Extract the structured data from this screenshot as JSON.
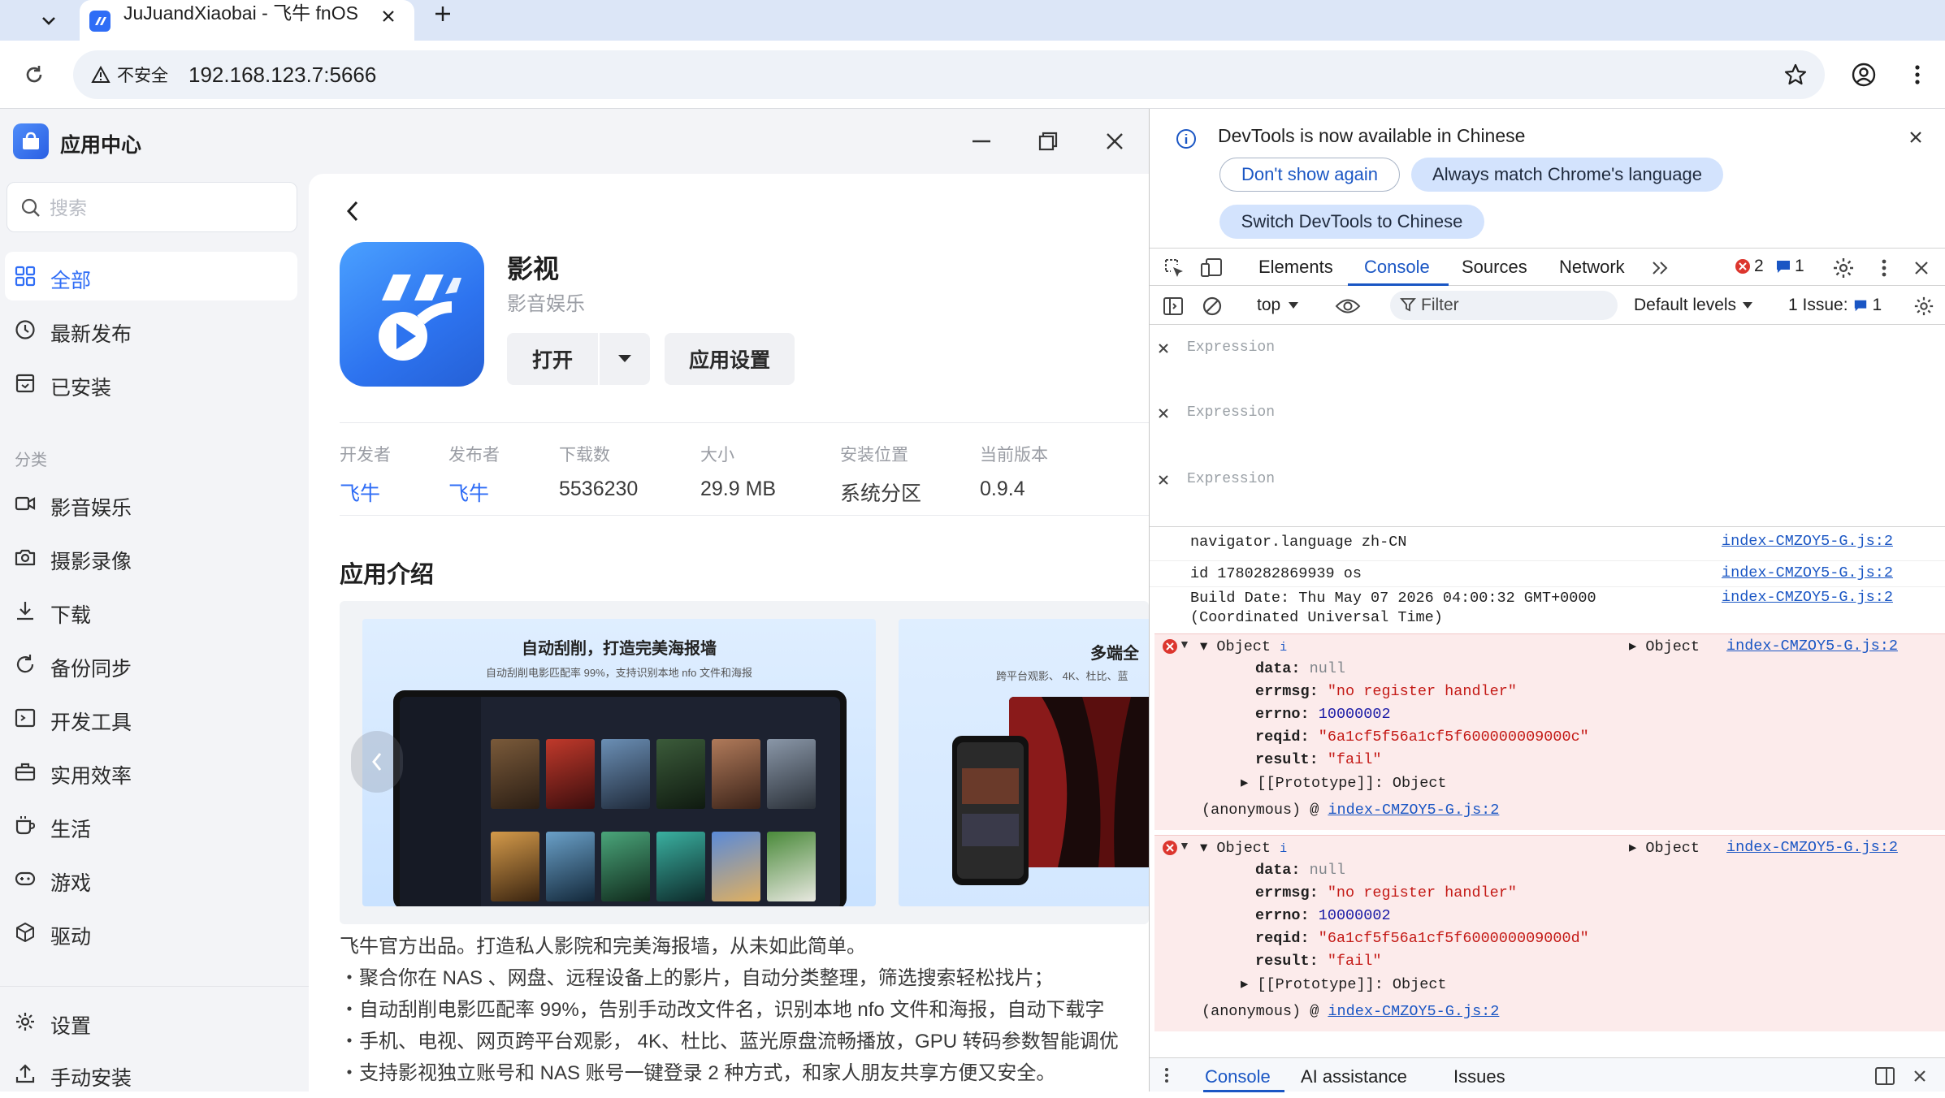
{
  "browser": {
    "tab_title": "JuJuandXiaobai - 飞牛 fnOS",
    "security_label": "不安全",
    "url": "192.168.123.7:5666",
    "favicon_color": "#2f6df6"
  },
  "app": {
    "window_title": "应用中心",
    "search_placeholder": "搜索",
    "nav": [
      {
        "label": "全部",
        "icon": "grid-icon",
        "active": true
      },
      {
        "label": "最新发布",
        "icon": "clock-icon"
      },
      {
        "label": "已安装",
        "icon": "installed-icon"
      }
    ],
    "category_heading": "分类",
    "categories": [
      {
        "label": "影音娱乐",
        "icon": "video-camera-icon"
      },
      {
        "label": "摄影录像",
        "icon": "camera-icon"
      },
      {
        "label": "下载",
        "icon": "download-icon"
      },
      {
        "label": "备份同步",
        "icon": "sync-icon"
      },
      {
        "label": "开发工具",
        "icon": "terminal-icon"
      },
      {
        "label": "实用效率",
        "icon": "toolbox-icon"
      },
      {
        "label": "生活",
        "icon": "cup-icon"
      },
      {
        "label": "游戏",
        "icon": "gamepad-icon"
      },
      {
        "label": "驱动",
        "icon": "cube-icon"
      }
    ],
    "bottom_nav": [
      {
        "label": "设置",
        "icon": "gear-icon"
      },
      {
        "label": "手动安装",
        "icon": "upload-icon"
      }
    ],
    "accent_color": "#2f6df6"
  },
  "detail": {
    "name": "影视",
    "category": "影音娱乐",
    "open_label": "打开",
    "settings_label": "应用设置",
    "meta": [
      {
        "key": "开发者",
        "value": "飞牛",
        "link": true
      },
      {
        "key": "发布者",
        "value": "飞牛",
        "link": true
      },
      {
        "key": "下载数",
        "value": "5536230"
      },
      {
        "key": "大小",
        "value": "29.9 MB"
      },
      {
        "key": "安装位置",
        "value": "系统分区"
      },
      {
        "key": "当前版本",
        "value": "0.9.4"
      }
    ],
    "intro_title": "应用介绍",
    "screenshot1_headline": "自动刮削，打造完美海报墙",
    "screenshot1_sub": "自动刮削电影匹配率 99%，支持识别本地 nfo 文件和海报",
    "screenshot2_headline": "多端全",
    "screenshot2_sub": "跨平台观影、 4K、杜比、蓝",
    "description": [
      "飞牛官方出品。打造私人影院和完美海报墙，从未如此简单。",
      "・聚合你在 NAS 、网盘、远程设备上的影片，自动分类整理，筛选搜索轻松找片；",
      "・自动刮削电影匹配率 99%，告别手动改文件名，识别本地 nfo 文件和海报，自动下载字",
      "・手机、电视、网页跨平台观影， 4K、杜比、蓝光原盘流畅播放，GPU 转码参数智能调优",
      "・支持影视独立账号和 NAS 账号一键登录 2 种方式，和家人朋友共享方便又安全。"
    ]
  },
  "devtools": {
    "banner_text": "DevTools is now available in Chinese",
    "dont_show": "Don't show again",
    "always_match": "Always match Chrome's language",
    "switch": "Switch DevTools to Chinese",
    "tabs": [
      "Elements",
      "Console",
      "Sources",
      "Network"
    ],
    "active_tab": "Console",
    "error_count": "2",
    "message_count": "1",
    "context": "top",
    "filter_placeholder": "Filter",
    "levels": "Default levels",
    "issue_label": "1 Issue:",
    "issue_count": "1",
    "expression_placeholder": "Expression",
    "logs": [
      {
        "msg": "navigator.language zh-CN",
        "src": "index-CMZOY5-G.js:2"
      },
      {
        "msg": "id 1780282869939 os",
        "src": "index-CMZOY5-G.js:2"
      },
      {
        "msg": "Build Date: Thu May 07 2026 04:00:32 GMT+0000\n(Coordinated Universal Time)",
        "src": "index-CMZOY5-G.js:2"
      }
    ],
    "errors": [
      {
        "head": "Object",
        "info": "i",
        "preview": "Object",
        "src": "index-CMZOY5-G.js:2",
        "data": "null",
        "errmsg": "\"no register handler\"",
        "errno": "10000002",
        "reqid": "\"6a1cf5f56a1cf5f600000009000c\"",
        "result": "\"fail\"",
        "proto": "[[Prototype]]: Object",
        "trace_prefix": "(anonymous) @ ",
        "trace_src": "index-CMZOY5-G.js:2"
      },
      {
        "head": "Object",
        "info": "i",
        "preview": "Object",
        "src": "index-CMZOY5-G.js:2",
        "data": "null",
        "errmsg": "\"no register handler\"",
        "errno": "10000002",
        "reqid": "\"6a1cf5f56a1cf5f600000009000d\"",
        "result": "\"fail\"",
        "proto": "[[Prototype]]: Object",
        "trace_prefix": "(anonymous) @ ",
        "trace_src": "index-CMZOY5-G.js:2"
      }
    ],
    "drawer_tabs": [
      "Console",
      "AI assistance",
      "Issues"
    ]
  }
}
